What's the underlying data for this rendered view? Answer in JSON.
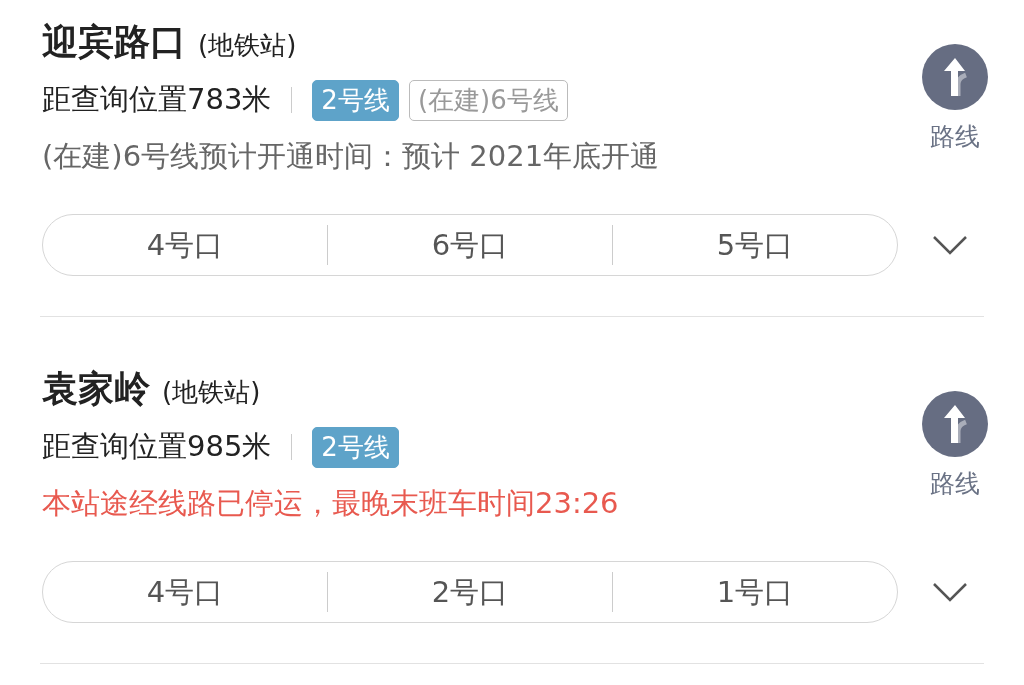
{
  "stations": [
    {
      "name": "迎宾路口",
      "type": "(地铁站)",
      "distance": "距查询位置783米",
      "lines": [
        {
          "label": "2号线",
          "kind": "active"
        },
        {
          "label": "(在建)6号线",
          "kind": "planned"
        }
      ],
      "notice": {
        "kind": "info",
        "text": "(在建)6号线预计开通时间：预计 2021年底开通"
      },
      "route_label": "路线",
      "exits": [
        "4号口",
        "6号口",
        "5号口"
      ]
    },
    {
      "name": "袁家岭",
      "type": "(地铁站)",
      "distance": "距查询位置985米",
      "lines": [
        {
          "label": "2号线",
          "kind": "active"
        }
      ],
      "notice": {
        "kind": "alert",
        "text": "本站途经线路已停运，最晚末班车时间23:26"
      },
      "route_label": "路线",
      "exits": [
        "4号口",
        "2号口",
        "1号口"
      ]
    }
  ]
}
